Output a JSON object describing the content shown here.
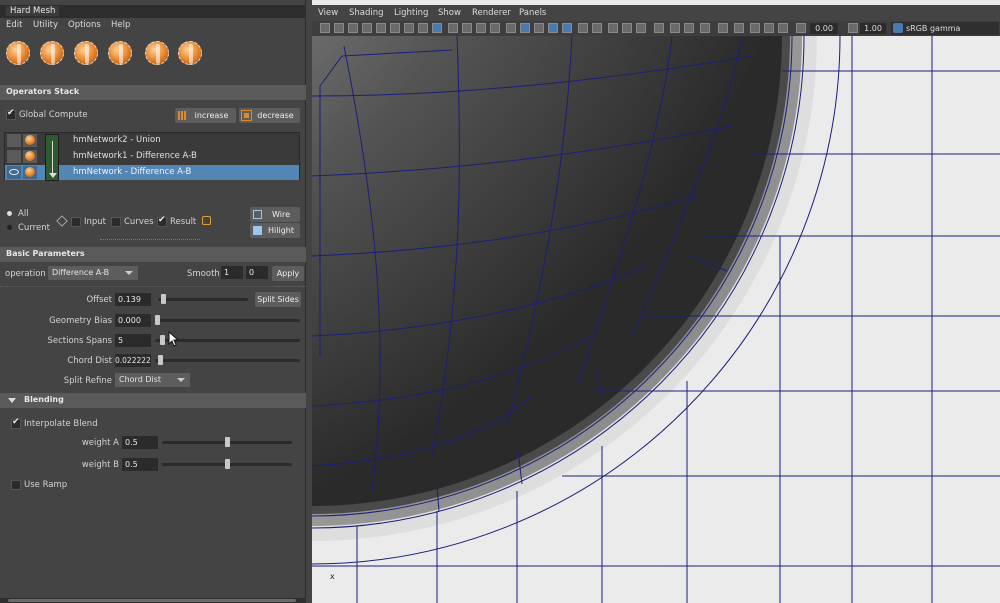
{
  "window": {
    "title": "Hard Mesh"
  },
  "menu": [
    "Edit",
    "Utility",
    "Options",
    "Help"
  ],
  "sections": {
    "operators": "Operators Stack",
    "basic": "Basic Parameters",
    "blending": "Blending"
  },
  "global_compute": {
    "label": "Global Compute",
    "checked": true
  },
  "buttons": {
    "increase": "increase",
    "decrease": "decrease",
    "wire": "Wire",
    "hilight": "Hilight",
    "apply": "Apply",
    "split_sides": "Split Sides"
  },
  "stack": [
    {
      "label": "hmNetwork2 - Union",
      "selected": false
    },
    {
      "label": "hmNetwork1 - Difference A-B",
      "selected": false
    },
    {
      "label": "hmNetwork - Difference A-B",
      "selected": true
    }
  ],
  "display": {
    "all": "All",
    "current": "Current",
    "input": "Input",
    "curves": "Curves",
    "result": "Result"
  },
  "basic": {
    "operation_label": "operation",
    "operation_value": "Difference A-B",
    "smooth_label": "Smooth",
    "smooth_a": "1",
    "smooth_b": "0",
    "offset_label": "Offset",
    "offset_value": "0.139",
    "geometry_bias_label": "Geometry Bias",
    "geometry_bias_value": "0.000",
    "sections_spans_label": "Sections Spans",
    "sections_spans_value": "5",
    "chord_dist_label": "Chord Dist",
    "chord_dist_value": "0.022222",
    "split_refine_label": "Split Refine",
    "split_refine_value": "Chord Dist"
  },
  "blending": {
    "interpolate_label": "Interpolate Blend",
    "weight_a_label": "weight A",
    "weight_a_value": "0.5",
    "weight_b_label": "weight B",
    "weight_b_value": "0.5",
    "use_ramp_label": "Use Ramp"
  },
  "viewport": {
    "menu": [
      "View",
      "Shading",
      "Lighting",
      "Show",
      "Renderer",
      "Panels"
    ],
    "exposure": "0.00",
    "gamma_value": "1.00",
    "colorspace": "sRGB gamma",
    "axis_label": "x"
  },
  "colors": {
    "accent": "#5385b5",
    "wire": "#1a1f7a"
  }
}
